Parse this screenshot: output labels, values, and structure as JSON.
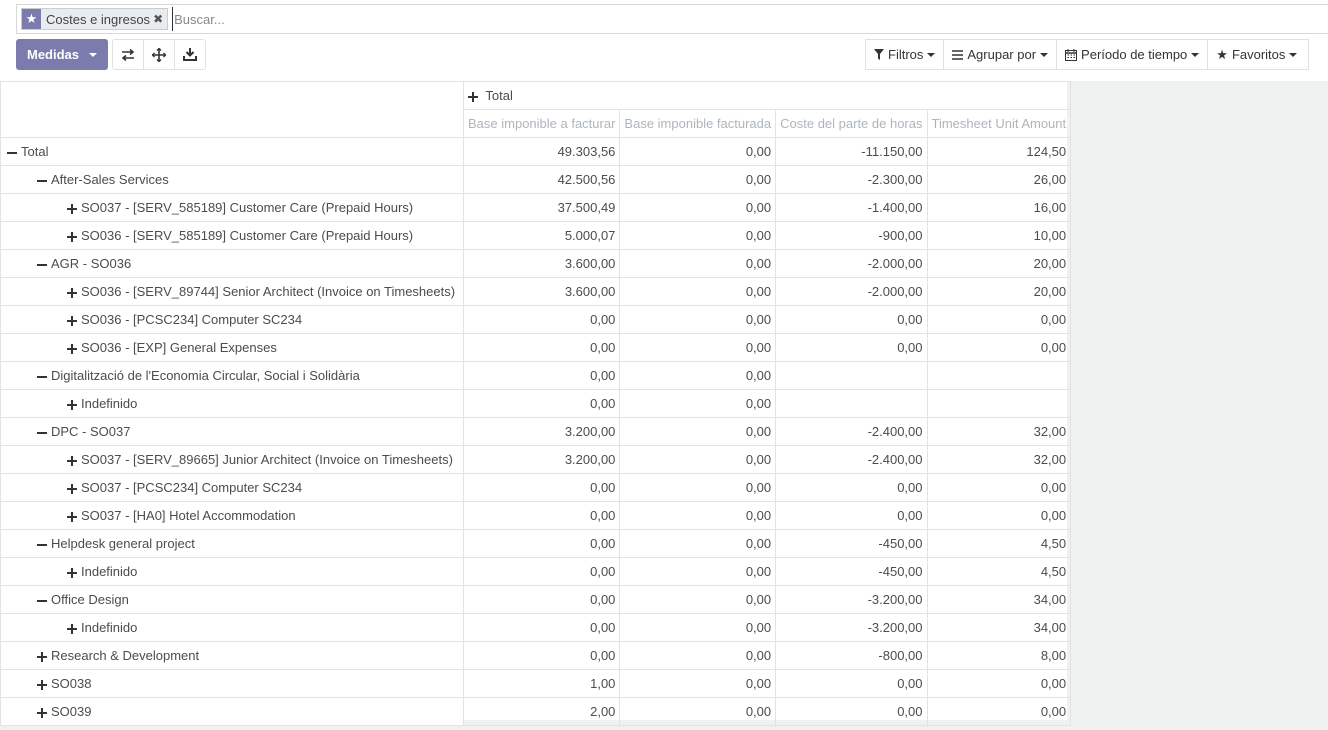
{
  "search": {
    "facet_label": "Costes e ingresos",
    "placeholder": "Buscar..."
  },
  "toolbar": {
    "measures_label": "Medidas",
    "filters_label": "Filtros",
    "groupby_label": "Agrupar por",
    "period_label": "Período de tiempo",
    "favorites_label": "Favoritos"
  },
  "icons": {
    "facet": "star-icon",
    "flip": "flip-axis-icon",
    "expand": "expand-all-icon",
    "download": "download-icon",
    "filter": "filter-icon",
    "groupby": "bars-icon",
    "period": "calendar-icon",
    "favorites": "star-icon"
  },
  "colors": {
    "primary": "#7c7bad",
    "header_text": "#adb5bd"
  },
  "table": {
    "col_header": "Total",
    "measures": [
      "Base imponible a facturar",
      "Base imponible facturada",
      "Coste del parte de horas",
      "Timesheet Unit Amount"
    ],
    "rows": [
      {
        "level": 0,
        "expanded": true,
        "label": "Total",
        "bold": true,
        "values": [
          "49.303,56",
          "0,00",
          "-11.150,00",
          "124,50"
        ]
      },
      {
        "level": 1,
        "expanded": true,
        "label": "After-Sales Services",
        "values": [
          "42.500,56",
          "0,00",
          "-2.300,00",
          "26,00"
        ]
      },
      {
        "level": 2,
        "expanded": false,
        "label": "SO037 - [SERV_585189] Customer Care (Prepaid Hours)",
        "values": [
          "37.500,49",
          "0,00",
          "-1.400,00",
          "16,00"
        ]
      },
      {
        "level": 2,
        "expanded": false,
        "label": "SO036 - [SERV_585189] Customer Care (Prepaid Hours)",
        "values": [
          "5.000,07",
          "0,00",
          "-900,00",
          "10,00"
        ]
      },
      {
        "level": 1,
        "expanded": true,
        "label": "AGR - SO036",
        "values": [
          "3.600,00",
          "0,00",
          "-2.000,00",
          "20,00"
        ]
      },
      {
        "level": 2,
        "expanded": false,
        "label": "SO036 - [SERV_89744] Senior Architect (Invoice on Timesheets)",
        "values": [
          "3.600,00",
          "0,00",
          "-2.000,00",
          "20,00"
        ]
      },
      {
        "level": 2,
        "expanded": false,
        "label": "SO036 - [PCSC234] Computer SC234",
        "values": [
          "0,00",
          "0,00",
          "0,00",
          "0,00"
        ]
      },
      {
        "level": 2,
        "expanded": false,
        "label": "SO036 - [EXP] General Expenses",
        "values": [
          "0,00",
          "0,00",
          "0,00",
          "0,00"
        ]
      },
      {
        "level": 1,
        "expanded": true,
        "label": "Digitalització de l'Economia Circular, Social i Solidària",
        "values": [
          "0,00",
          "0,00",
          "",
          ""
        ]
      },
      {
        "level": 2,
        "expanded": false,
        "label": "Indefinido",
        "values": [
          "0,00",
          "0,00",
          "",
          ""
        ]
      },
      {
        "level": 1,
        "expanded": true,
        "label": "DPC - SO037",
        "values": [
          "3.200,00",
          "0,00",
          "-2.400,00",
          "32,00"
        ]
      },
      {
        "level": 2,
        "expanded": false,
        "label": "SO037 - [SERV_89665] Junior Architect (Invoice on Timesheets)",
        "values": [
          "3.200,00",
          "0,00",
          "-2.400,00",
          "32,00"
        ]
      },
      {
        "level": 2,
        "expanded": false,
        "label": "SO037 - [PCSC234] Computer SC234",
        "values": [
          "0,00",
          "0,00",
          "0,00",
          "0,00"
        ]
      },
      {
        "level": 2,
        "expanded": false,
        "label": "SO037 - [HA0] Hotel Accommodation",
        "values": [
          "0,00",
          "0,00",
          "0,00",
          "0,00"
        ]
      },
      {
        "level": 1,
        "expanded": true,
        "label": "Helpdesk general project",
        "values": [
          "0,00",
          "0,00",
          "-450,00",
          "4,50"
        ]
      },
      {
        "level": 2,
        "expanded": false,
        "label": "Indefinido",
        "values": [
          "0,00",
          "0,00",
          "-450,00",
          "4,50"
        ]
      },
      {
        "level": 1,
        "expanded": true,
        "label": "Office Design",
        "values": [
          "0,00",
          "0,00",
          "-3.200,00",
          "34,00"
        ]
      },
      {
        "level": 2,
        "expanded": false,
        "label": "Indefinido",
        "values": [
          "0,00",
          "0,00",
          "-3.200,00",
          "34,00"
        ]
      },
      {
        "level": 1,
        "expanded": false,
        "label": "Research & Development",
        "values": [
          "0,00",
          "0,00",
          "-800,00",
          "8,00"
        ]
      },
      {
        "level": 1,
        "expanded": false,
        "label": "SO038",
        "values": [
          "1,00",
          "0,00",
          "0,00",
          "0,00"
        ]
      },
      {
        "level": 1,
        "expanded": false,
        "label": "SO039",
        "values": [
          "2,00",
          "0,00",
          "0,00",
          "0,00"
        ]
      }
    ]
  }
}
